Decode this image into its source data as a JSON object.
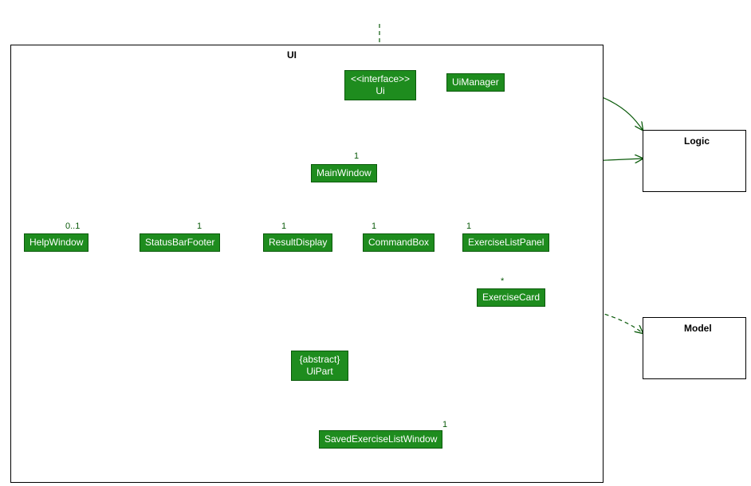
{
  "diagram": {
    "type": "uml-class-diagram",
    "packages": {
      "ui": {
        "label": "UI"
      }
    },
    "external": {
      "logic": {
        "label": "Logic"
      },
      "model": {
        "label": "Model"
      }
    },
    "classes": {
      "ui_interface": {
        "stereotype_line": "<<interface>>",
        "name": "Ui"
      },
      "ui_manager": {
        "name": "UiManager"
      },
      "main_window": {
        "name": "MainWindow"
      },
      "help_window": {
        "name": "HelpWindow"
      },
      "status_bar": {
        "name": "StatusBarFooter"
      },
      "result_disp": {
        "name": "ResultDisplay"
      },
      "command_box": {
        "name": "CommandBox"
      },
      "ex_list_panel": {
        "name": "ExerciseListPanel"
      },
      "ex_card": {
        "name": "ExerciseCard"
      },
      "ui_part": {
        "stereotype_line": "{abstract}",
        "name": "UiPart"
      },
      "saved_win": {
        "name": "SavedExerciseListWindow"
      }
    },
    "multiplicities": {
      "mw_from_uimgr": "1",
      "help_win": "0..1",
      "status_bar": "1",
      "result_disp": "1",
      "command_box": "1",
      "ex_list_panel": "1",
      "ex_card": "*",
      "saved_win": "1"
    },
    "relations": [
      {
        "from": "external-entry",
        "to": "ui_interface",
        "kind": "dependency"
      },
      {
        "from": "ui_manager",
        "to": "ui_interface",
        "kind": "realization"
      },
      {
        "from": "ui_manager",
        "to": "main_window",
        "kind": "association",
        "mult_to": "1"
      },
      {
        "from": "ui_manager",
        "to": "logic",
        "kind": "association-arrow"
      },
      {
        "from": "main_window",
        "to": "logic",
        "kind": "association-arrow"
      },
      {
        "from": "main_window",
        "to": "help_window",
        "kind": "composition",
        "mult_to": "0..1"
      },
      {
        "from": "main_window",
        "to": "status_bar",
        "kind": "composition",
        "mult_to": "1"
      },
      {
        "from": "main_window",
        "to": "result_disp",
        "kind": "composition",
        "mult_to": "1"
      },
      {
        "from": "main_window",
        "to": "command_box",
        "kind": "composition",
        "mult_to": "1"
      },
      {
        "from": "main_window",
        "to": "ex_list_panel",
        "kind": "composition",
        "mult_to": "1"
      },
      {
        "from": "main_window",
        "to": "saved_win",
        "kind": "composition",
        "mult_to": "1"
      },
      {
        "from": "ex_list_panel",
        "to": "ex_card",
        "kind": "association-arrow",
        "mult_to": "*"
      },
      {
        "from": "main_window",
        "to": "ui_part",
        "kind": "generalization"
      },
      {
        "from": "help_window",
        "to": "ui_part",
        "kind": "generalization"
      },
      {
        "from": "status_bar",
        "to": "ui_part",
        "kind": "generalization"
      },
      {
        "from": "result_disp",
        "to": "ui_part",
        "kind": "generalization"
      },
      {
        "from": "command_box",
        "to": "ui_part",
        "kind": "generalization"
      },
      {
        "from": "ex_list_panel",
        "to": "ui_part",
        "kind": "generalization"
      },
      {
        "from": "ex_card",
        "to": "ui_part",
        "kind": "generalization"
      },
      {
        "from": "ui_manager",
        "to": "ui_part",
        "kind": "generalization"
      },
      {
        "from": "saved_win",
        "to": "ui_part",
        "kind": "generalization"
      },
      {
        "from": "ex_card",
        "to": "model",
        "kind": "dependency"
      }
    ]
  },
  "colors": {
    "class_fill": "#1e8c1e",
    "class_border": "#0a5a0a",
    "line": "#0a5a0a"
  }
}
